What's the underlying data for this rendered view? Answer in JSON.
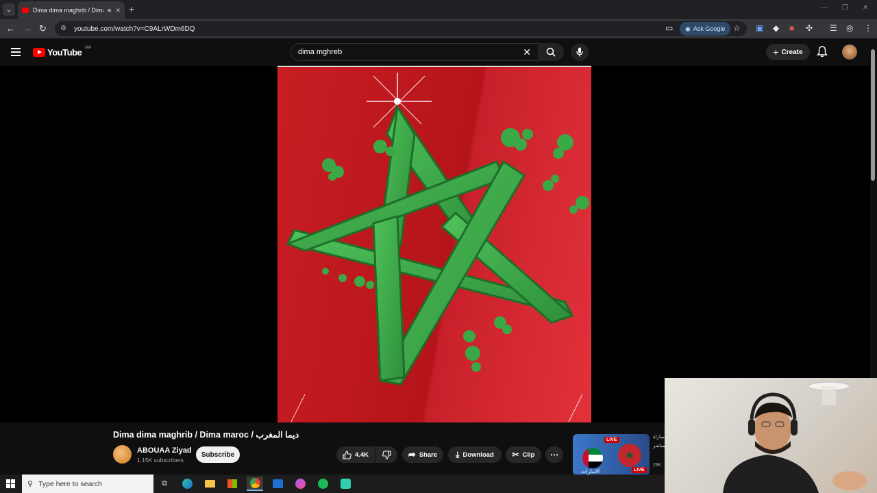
{
  "browser": {
    "tab_title": "Dima dima maghrib / Dima",
    "url": "youtube.com/watch?v=C9ALrWDm6DQ",
    "ask_google_label": "Ask Google"
  },
  "youtube": {
    "logo_text": "YouTube",
    "region": "MA",
    "search_value": "dima mghreb",
    "create_label": "Create"
  },
  "video": {
    "title": "Dima dima maghrib / Dima maroc / ديما المغرب",
    "channel": "ABOUAA Ziyad",
    "subscribers": "1.15K subscribers",
    "subscribe_label": "Subscribe",
    "likes": "4.4K",
    "share_label": "Share",
    "download_label": "Download",
    "clip_label": "Clip"
  },
  "up_next": {
    "live_badge_1": "LIVE",
    "live_badge_2": "LIVE",
    "views_partial": "29K",
    "arabic_text_1": "مباراة",
    "arabic_text_2": "مباشر",
    "arabic_caption": "الامارات"
  },
  "taskbar": {
    "search_placeholder": "Type here to search"
  },
  "colors": {
    "youtube_red": "#ff0000",
    "flag_red": "#c81e24",
    "star_green": "#3aa845"
  }
}
